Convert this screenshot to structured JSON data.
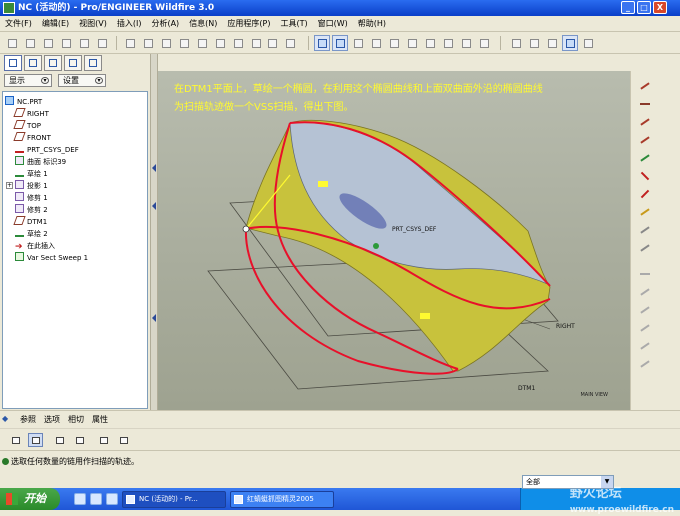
{
  "window": {
    "title": "NC (活动的) - Pro/ENGINEER Wildfire 3.0",
    "controls": [
      "_",
      "□",
      "X"
    ]
  },
  "menu": [
    "文件(F)",
    "编辑(E)",
    "视图(V)",
    "插入(I)",
    "分析(A)",
    "信息(N)",
    "应用程序(P)",
    "工具(T)",
    "窗口(W)",
    "帮助(H)"
  ],
  "model_tree": {
    "show_label": "显示",
    "settings_label": "设置",
    "items": [
      {
        "label": "NC.PRT",
        "icon": "part-icon"
      },
      {
        "label": "RIGHT",
        "icon": "datum-plane-icon"
      },
      {
        "label": "TOP",
        "icon": "datum-plane-icon"
      },
      {
        "label": "FRONT",
        "icon": "datum-plane-icon"
      },
      {
        "label": "PRT_CSYS_DEF",
        "icon": "csys-icon"
      },
      {
        "label": "曲面 标识39",
        "icon": "surface-icon"
      },
      {
        "label": "草绘 1",
        "icon": "sketch-icon"
      },
      {
        "label": "投影 1",
        "icon": "projection-icon",
        "expand": "+"
      },
      {
        "label": "修剪 1",
        "icon": "trim-icon"
      },
      {
        "label": "修剪 2",
        "icon": "trim-icon"
      },
      {
        "label": "DTM1",
        "icon": "datum-plane-icon"
      },
      {
        "label": "草绘 2",
        "icon": "sketch-icon"
      },
      {
        "label": "在此插入",
        "icon": "insert-arrow-icon"
      },
      {
        "label": "Var Sect Sweep 1",
        "icon": "sweep-icon"
      }
    ]
  },
  "viewport": {
    "annotation_line1": "在DTM1平面上，草绘一个椭圆，在利用这个椭圆曲线和上面双曲面外沿的椭圆曲线",
    "annotation_line2": "为扫描轨迹做一个VSS扫描，得出下图。",
    "labels": {
      "csys": "PRT_CSYS_DEF",
      "right": "RIGHT",
      "dtm1": "DTM1",
      "corner": "MAIN VIEW"
    }
  },
  "dashboard": {
    "tabs": [
      "参照",
      "选项",
      "相切",
      "属性"
    ],
    "message": "选取任何数量的链用作扫描的轨迹。",
    "filter": "全部"
  },
  "taskbar": {
    "start": "开始",
    "tasks": [
      "NC (活动的) - Pr...",
      "红蜻蜓抓图精灵2005"
    ],
    "watermark": "野火论坛",
    "watermark_sub": "www.proewildfire.cn"
  },
  "colors": {
    "annotation": "#fffa30",
    "edge_highlight": "#e8102a",
    "surface": "#c8c23c",
    "viewport_bg": "#a9ad9d"
  }
}
